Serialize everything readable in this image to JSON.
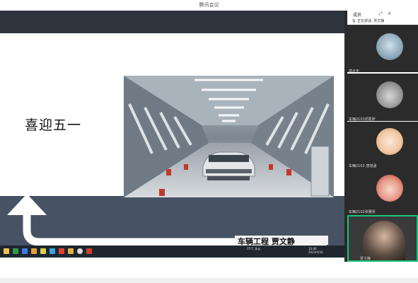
{
  "window": {
    "title": "腾讯会议"
  },
  "slide": {
    "title": "喜迎五一",
    "caption": "车辆工程 贾文静"
  },
  "panel": {
    "title": "成员",
    "speaking_label": "正在讲话:",
    "speaking_name": "贾文静"
  },
  "participants": [
    {
      "name": "高云天"
    },
    {
      "name": "车辆2103邓凯昕"
    },
    {
      "name": "车辆2102 唐旭涵"
    },
    {
      "name": "车辆2102张雅琴"
    },
    {
      "name": "贾文静"
    }
  ],
  "taskbar": {
    "weather": "25°C 多云",
    "time": "10:46",
    "date": "2023/4/30"
  },
  "colors": {
    "slide_top": "#2e353f",
    "slide_band": "#475364",
    "panel_tile": "#2b2b2b",
    "active_border": "#19c37d"
  }
}
